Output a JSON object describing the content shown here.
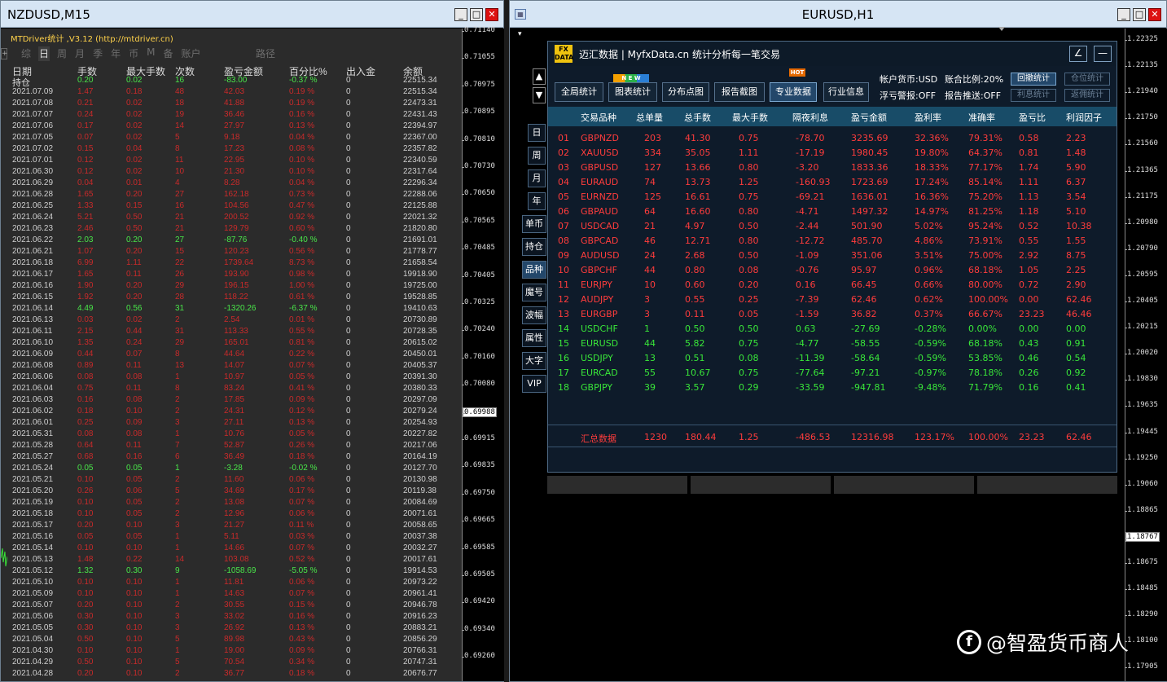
{
  "left_window": {
    "title": "NZDUSD,M15",
    "buttons": [
      "_",
      "□",
      "✕"
    ],
    "header": "MTDriver统计 ,V3.12 (http://mtdriver.cn)",
    "side_plus": "+",
    "nav": [
      "综",
      "日",
      "周",
      "月",
      "季",
      "年",
      "币",
      "M",
      "备",
      "账户"
    ],
    "nav_active": "日",
    "path_label": "路径",
    "columns": [
      "日期",
      "手数",
      "最大手数",
      "次数",
      "盈亏金额",
      "百分比%",
      "出入金",
      "余额"
    ],
    "rows": [
      [
        "持仓",
        "0.20",
        "0.02",
        "16",
        "-83.00",
        "-0.37 %",
        "0",
        "22515.34",
        "g"
      ],
      [
        "2021.07.09",
        "1.47",
        "0.18",
        "48",
        "42.03",
        "0.19 %",
        "0",
        "22515.34",
        "r"
      ],
      [
        "2021.07.08",
        "0.21",
        "0.02",
        "18",
        "41.88",
        "0.19 %",
        "0",
        "22473.31",
        "r"
      ],
      [
        "2021.07.07",
        "0.24",
        "0.02",
        "19",
        "36.46",
        "0.16 %",
        "0",
        "22431.43",
        "r"
      ],
      [
        "2021.07.06",
        "0.17",
        "0.02",
        "14",
        "27.97",
        "0.13 %",
        "0",
        "22394.97",
        "r"
      ],
      [
        "2021.07.05",
        "0.07",
        "0.02",
        "5",
        "9.18",
        "0.04 %",
        "0",
        "22367.00",
        "r"
      ],
      [
        "2021.07.02",
        "0.15",
        "0.04",
        "8",
        "17.23",
        "0.08 %",
        "0",
        "22357.82",
        "r"
      ],
      [
        "2021.07.01",
        "0.12",
        "0.02",
        "11",
        "22.95",
        "0.10 %",
        "0",
        "22340.59",
        "r"
      ],
      [
        "2021.06.30",
        "0.12",
        "0.02",
        "10",
        "21.30",
        "0.10 %",
        "0",
        "22317.64",
        "r"
      ],
      [
        "2021.06.29",
        "0.04",
        "0.01",
        "4",
        "8.28",
        "0.04 %",
        "0",
        "22296.34",
        "r"
      ],
      [
        "2021.06.28",
        "1.65",
        "0.20",
        "27",
        "162.18",
        "0.73 %",
        "0",
        "22288.06",
        "r"
      ],
      [
        "2021.06.25",
        "1.33",
        "0.15",
        "16",
        "104.56",
        "0.47 %",
        "0",
        "22125.88",
        "r"
      ],
      [
        "2021.06.24",
        "5.21",
        "0.50",
        "21",
        "200.52",
        "0.92 %",
        "0",
        "22021.32",
        "r"
      ],
      [
        "2021.06.23",
        "2.46",
        "0.50",
        "21",
        "129.79",
        "0.60 %",
        "0",
        "21820.80",
        "r"
      ],
      [
        "2021.06.22",
        "2.03",
        "0.20",
        "27",
        "-87.76",
        "-0.40 %",
        "0",
        "21691.01",
        "g"
      ],
      [
        "2021.06.21",
        "1.07",
        "0.20",
        "15",
        "120.23",
        "0.56 %",
        "0",
        "21778.77",
        "r"
      ],
      [
        "2021.06.18",
        "6.99",
        "1.11",
        "22",
        "1739.64",
        "8.73 %",
        "0",
        "21658.54",
        "r"
      ],
      [
        "2021.06.17",
        "1.65",
        "0.11",
        "26",
        "193.90",
        "0.98 %",
        "0",
        "19918.90",
        "r"
      ],
      [
        "2021.06.16",
        "1.90",
        "0.20",
        "29",
        "196.15",
        "1.00 %",
        "0",
        "19725.00",
        "r"
      ],
      [
        "2021.06.15",
        "1.92",
        "0.20",
        "28",
        "118.22",
        "0.61 %",
        "0",
        "19528.85",
        "r"
      ],
      [
        "2021.06.14",
        "4.49",
        "0.56",
        "31",
        "-1320.26",
        "-6.37 %",
        "0",
        "19410.63",
        "g"
      ],
      [
        "2021.06.13",
        "0.03",
        "0.02",
        "2",
        "2.54",
        "0.01 %",
        "0",
        "20730.89",
        "r"
      ],
      [
        "2021.06.11",
        "2.15",
        "0.44",
        "31",
        "113.33",
        "0.55 %",
        "0",
        "20728.35",
        "r"
      ],
      [
        "2021.06.10",
        "1.35",
        "0.24",
        "29",
        "165.01",
        "0.81 %",
        "0",
        "20615.02",
        "r"
      ],
      [
        "2021.06.09",
        "0.44",
        "0.07",
        "8",
        "44.64",
        "0.22 %",
        "0",
        "20450.01",
        "r"
      ],
      [
        "2021.06.08",
        "0.89",
        "0.11",
        "13",
        "14.07",
        "0.07 %",
        "0",
        "20405.37",
        "r"
      ],
      [
        "2021.06.06",
        "0.08",
        "0.08",
        "1",
        "10.97",
        "0.05 %",
        "0",
        "20391.30",
        "r"
      ],
      [
        "2021.06.04",
        "0.75",
        "0.11",
        "8",
        "83.24",
        "0.41 %",
        "0",
        "20380.33",
        "r"
      ],
      [
        "2021.06.03",
        "0.16",
        "0.08",
        "2",
        "17.85",
        "0.09 %",
        "0",
        "20297.09",
        "r"
      ],
      [
        "2021.06.02",
        "0.18",
        "0.10",
        "2",
        "24.31",
        "0.12 %",
        "0",
        "20279.24",
        "r"
      ],
      [
        "2021.06.01",
        "0.25",
        "0.09",
        "3",
        "27.11",
        "0.13 %",
        "0",
        "20254.93",
        "r"
      ],
      [
        "2021.05.31",
        "0.08",
        "0.08",
        "1",
        "10.76",
        "0.05 %",
        "0",
        "20227.82",
        "r"
      ],
      [
        "2021.05.28",
        "0.64",
        "0.11",
        "7",
        "52.87",
        "0.26 %",
        "0",
        "20217.06",
        "r"
      ],
      [
        "2021.05.27",
        "0.68",
        "0.16",
        "6",
        "36.49",
        "0.18 %",
        "0",
        "20164.19",
        "r"
      ],
      [
        "2021.05.24",
        "0.05",
        "0.05",
        "1",
        "-3.28",
        "-0.02 %",
        "0",
        "20127.70",
        "g"
      ],
      [
        "2021.05.21",
        "0.10",
        "0.05",
        "2",
        "11.60",
        "0.06 %",
        "0",
        "20130.98",
        "r"
      ],
      [
        "2021.05.20",
        "0.26",
        "0.06",
        "5",
        "34.69",
        "0.17 %",
        "0",
        "20119.38",
        "r"
      ],
      [
        "2021.05.19",
        "0.10",
        "0.05",
        "2",
        "13.08",
        "0.07 %",
        "0",
        "20084.69",
        "r"
      ],
      [
        "2021.05.18",
        "0.10",
        "0.05",
        "2",
        "12.96",
        "0.06 %",
        "0",
        "20071.61",
        "r"
      ],
      [
        "2021.05.17",
        "0.20",
        "0.10",
        "3",
        "21.27",
        "0.11 %",
        "0",
        "20058.65",
        "r"
      ],
      [
        "2021.05.16",
        "0.05",
        "0.05",
        "1",
        "5.11",
        "0.03 %",
        "0",
        "20037.38",
        "r"
      ],
      [
        "2021.05.14",
        "0.10",
        "0.10",
        "1",
        "14.66",
        "0.07 %",
        "0",
        "20032.27",
        "r"
      ],
      [
        "2021.05.13",
        "1.48",
        "0.22",
        "14",
        "103.08",
        "0.52 %",
        "0",
        "20017.61",
        "r"
      ],
      [
        "2021.05.12",
        "1.32",
        "0.30",
        "9",
        "-1058.69",
        "-5.05 %",
        "0",
        "19914.53",
        "g"
      ],
      [
        "2021.05.10",
        "0.10",
        "0.10",
        "1",
        "11.81",
        "0.06 %",
        "0",
        "20973.22",
        "r"
      ],
      [
        "2021.05.09",
        "0.10",
        "0.10",
        "1",
        "14.63",
        "0.07 %",
        "0",
        "20961.41",
        "r"
      ],
      [
        "2021.05.07",
        "0.20",
        "0.10",
        "2",
        "30.55",
        "0.15 %",
        "0",
        "20946.78",
        "r"
      ],
      [
        "2021.05.06",
        "0.30",
        "0.10",
        "3",
        "33.02",
        "0.16 %",
        "0",
        "20916.23",
        "r"
      ],
      [
        "2021.05.05",
        "0.30",
        "0.10",
        "3",
        "26.92",
        "0.13 %",
        "0",
        "20883.21",
        "r"
      ],
      [
        "2021.05.04",
        "0.50",
        "0.10",
        "5",
        "89.98",
        "0.43 %",
        "0",
        "20856.29",
        "r"
      ],
      [
        "2021.04.30",
        "0.10",
        "0.10",
        "1",
        "19.00",
        "0.09 %",
        "0",
        "20766.31",
        "r"
      ],
      [
        "2021.04.29",
        "0.50",
        "0.10",
        "5",
        "70.54",
        "0.34 %",
        "0",
        "20747.31",
        "r"
      ],
      [
        "2021.04.28",
        "0.20",
        "0.10",
        "2",
        "36.77",
        "0.18 %",
        "0",
        "20676.77",
        "r"
      ]
    ],
    "axis_ticks": [
      "0.71140",
      "0.71055",
      "0.70975",
      "0.70895",
      "0.70810",
      "0.70730",
      "0.70650",
      "0.70565",
      "0.70485",
      "0.70405",
      "0.70325",
      "0.70240",
      "0.70160",
      "0.70080",
      "0.69988",
      "0.69915",
      "0.69835",
      "0.69750",
      "0.69665",
      "0.69585",
      "0.69505",
      "0.69420",
      "0.69340",
      "0.69260"
    ],
    "axis_highlight": "0.69988"
  },
  "right_window": {
    "title": "EURUSD,H1",
    "buttons": [
      "_",
      "□",
      "✕"
    ],
    "app_icon": "chart-window-icon",
    "dropdown_marker": "▾",
    "fx": {
      "logo": "FX DATA",
      "title": "迈汇数据 | MyfxData.cn  统计分析每一笔交易",
      "edit_icon": "∠",
      "min_icon": "—",
      "tabs": [
        "全局统计",
        "图表统计",
        "分布点图",
        "报告截图",
        "专业数据",
        "行业信息"
      ],
      "tab_selected": "专业数据",
      "badge_new": "N E W",
      "badge_hot": "HOT",
      "acct_currency": "帐户货币:USD",
      "combine_ratio": "账合比例:20%",
      "float_alert": "浮亏警报:OFF",
      "report_push": "报告推送:OFF",
      "small_btns": [
        "回撤统计",
        "仓位统计",
        "利息统计",
        "返佣统计"
      ],
      "small_on": "回撤统计",
      "columns": [
        "交易品种",
        "总单量",
        "总手数",
        "最大手数",
        "隔夜利息",
        "盈亏金额",
        "盈利率",
        "准确率",
        "盈亏比",
        "利润因子"
      ],
      "rows": [
        [
          "01",
          "GBPNZD",
          "203",
          "41.30",
          "0.75",
          "-78.70",
          "3235.69",
          "32.36%",
          "79.31%",
          "0.58",
          "2.23",
          "r"
        ],
        [
          "02",
          "XAUUSD",
          "334",
          "35.05",
          "1.11",
          "-17.19",
          "1980.45",
          "19.80%",
          "64.37%",
          "0.81",
          "1.48",
          "r"
        ],
        [
          "03",
          "GBPUSD",
          "127",
          "13.66",
          "0.80",
          "-3.20",
          "1833.36",
          "18.33%",
          "77.17%",
          "1.74",
          "5.90",
          "r"
        ],
        [
          "04",
          "EURAUD",
          "74",
          "13.73",
          "1.25",
          "-160.93",
          "1723.69",
          "17.24%",
          "85.14%",
          "1.11",
          "6.37",
          "r"
        ],
        [
          "05",
          "EURNZD",
          "125",
          "16.61",
          "0.75",
          "-69.21",
          "1636.01",
          "16.36%",
          "75.20%",
          "1.13",
          "3.54",
          "r"
        ],
        [
          "06",
          "GBPAUD",
          "64",
          "16.60",
          "0.80",
          "-4.71",
          "1497.32",
          "14.97%",
          "81.25%",
          "1.18",
          "5.10",
          "r"
        ],
        [
          "07",
          "USDCAD",
          "21",
          "4.97",
          "0.50",
          "-2.44",
          "501.90",
          "5.02%",
          "95.24%",
          "0.52",
          "10.38",
          "r"
        ],
        [
          "08",
          "GBPCAD",
          "46",
          "12.71",
          "0.80",
          "-12.72",
          "485.70",
          "4.86%",
          "73.91%",
          "0.55",
          "1.55",
          "r"
        ],
        [
          "09",
          "AUDUSD",
          "24",
          "2.68",
          "0.50",
          "-1.09",
          "351.06",
          "3.51%",
          "75.00%",
          "2.92",
          "8.75",
          "r"
        ],
        [
          "10",
          "GBPCHF",
          "44",
          "0.80",
          "0.08",
          "-0.76",
          "95.97",
          "0.96%",
          "68.18%",
          "1.05",
          "2.25",
          "r"
        ],
        [
          "11",
          "EURJPY",
          "10",
          "0.60",
          "0.20",
          "0.16",
          "66.45",
          "0.66%",
          "80.00%",
          "0.72",
          "2.90",
          "r"
        ],
        [
          "12",
          "AUDJPY",
          "3",
          "0.55",
          "0.25",
          "-7.39",
          "62.46",
          "0.62%",
          "100.00%",
          "0.00",
          "62.46",
          "r"
        ],
        [
          "13",
          "EURGBP",
          "3",
          "0.11",
          "0.05",
          "-1.59",
          "36.82",
          "0.37%",
          "66.67%",
          "23.23",
          "46.46",
          "r"
        ],
        [
          "14",
          "USDCHF",
          "1",
          "0.50",
          "0.50",
          "0.63",
          "-27.69",
          "-0.28%",
          "0.00%",
          "0.00",
          "0.00",
          "g"
        ],
        [
          "15",
          "EURUSD",
          "44",
          "5.82",
          "0.75",
          "-4.77",
          "-58.55",
          "-0.59%",
          "68.18%",
          "0.43",
          "0.91",
          "g"
        ],
        [
          "16",
          "USDJPY",
          "13",
          "0.51",
          "0.08",
          "-11.39",
          "-58.64",
          "-0.59%",
          "53.85%",
          "0.46",
          "0.54",
          "g"
        ],
        [
          "17",
          "EURCAD",
          "55",
          "10.67",
          "0.75",
          "-77.64",
          "-97.21",
          "-0.97%",
          "78.18%",
          "0.26",
          "0.92",
          "g"
        ],
        [
          "18",
          "GBPJPY",
          "39",
          "3.57",
          "0.29",
          "-33.59",
          "-947.81",
          "-9.48%",
          "71.79%",
          "0.16",
          "0.41",
          "g"
        ]
      ],
      "summary": [
        "汇总数据",
        "1230",
        "180.44",
        "1.25",
        "-486.53",
        "12316.98",
        "123.17%",
        "100.00%",
        "23.23",
        "62.46"
      ],
      "side_buttons": [
        "日",
        "周",
        "月",
        "年",
        "单币",
        "持仓",
        "品种",
        "魔号",
        "波幅",
        "属性",
        "大字",
        "VIP"
      ],
      "side_selected": "品种",
      "up_arrow": "▲",
      "down_arrow": "▼"
    },
    "axis_ticks": [
      "1.22325",
      "1.22135",
      "1.21940",
      "1.21750",
      "1.21560",
      "1.21365",
      "1.21175",
      "1.20980",
      "1.20790",
      "1.20595",
      "1.20405",
      "1.20215",
      "1.20020",
      "1.19830",
      "1.19635",
      "1.19445",
      "1.19250",
      "1.19060",
      "1.18865",
      "1.18767",
      "1.18675",
      "1.18485",
      "1.18290",
      "1.18100",
      "1.17905"
    ],
    "axis_highlight": "1.18767"
  },
  "watermark": {
    "icon": "f",
    "text": "@智盈货币商人"
  },
  "colors": {
    "profit": "#ff3c3c",
    "loss": "#39e639",
    "header_bar": "#184c68",
    "title_bar": "#d6e5f4"
  }
}
